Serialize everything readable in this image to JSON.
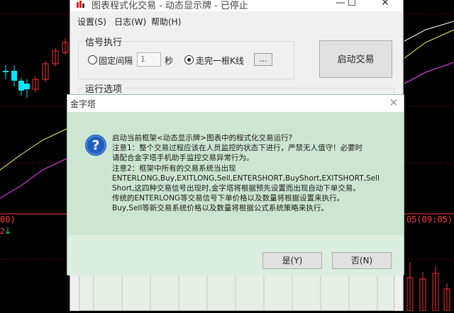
{
  "background_chart": {
    "left_axis_fragment": "00)",
    "left_counter": "2",
    "right_axis_fragment": "05(09:05)"
  },
  "main_window": {
    "title": "图表程式化交易 - 动态显示牌 - 已停止",
    "controls": {
      "minimize": "—",
      "maximize": "☐",
      "close": "✕"
    },
    "menu": [
      "设置(S)",
      "日志(W)",
      "帮助(H)"
    ],
    "signal_group": {
      "legend": "信号执行",
      "option_fixed_interval": "固定间隔",
      "interval_value": "1",
      "interval_unit": "秒",
      "option_after_bar": "走完一根K线",
      "option_after_bar_checked": true,
      "option_fixed_interval_checked": false,
      "ellipsis_button": "...",
      "start_button": "启动交易"
    },
    "run_group": {
      "legend": "运行选项"
    }
  },
  "dialog": {
    "title": "金字塔",
    "close": "✕",
    "icon": "question-icon",
    "icon_glyph": "?",
    "lines": [
      "启动当前框架<动态显示牌>图表中的程式化交易运行?",
      "注意1：整个交易过程应该在人员监控的状态下进行，严禁无人值守！必要时",
      "请配合金字塔手机助手监控交易异常行为。",
      "注意2：框架中所有的交易系统当出现",
      "ENTERLONG,Buy,EXITLONG,Sell,ENTERSHORT,BuyShort,EXITSHORT,Sell",
      "Short,这四种交易信号出现时,金字塔将根据预先设置而出现自动下单交易。",
      "传统的ENTERLONG等交易信号下单价格以及数量将根据设置来执行。",
      "Buy,Sell等新交易系统价格以及数量将根据公式系统策略来执行。"
    ],
    "yes_button": "是(Y)",
    "no_button": "否(N)"
  },
  "colors": {
    "dialog_body": "#cde6d2",
    "dialog_footer": "#dceee0",
    "question_icon": "#1f5fc0",
    "up_candle": "#ff2d2d",
    "down_candle": "#00e5ff",
    "axis_red": "#ff3b3b"
  }
}
